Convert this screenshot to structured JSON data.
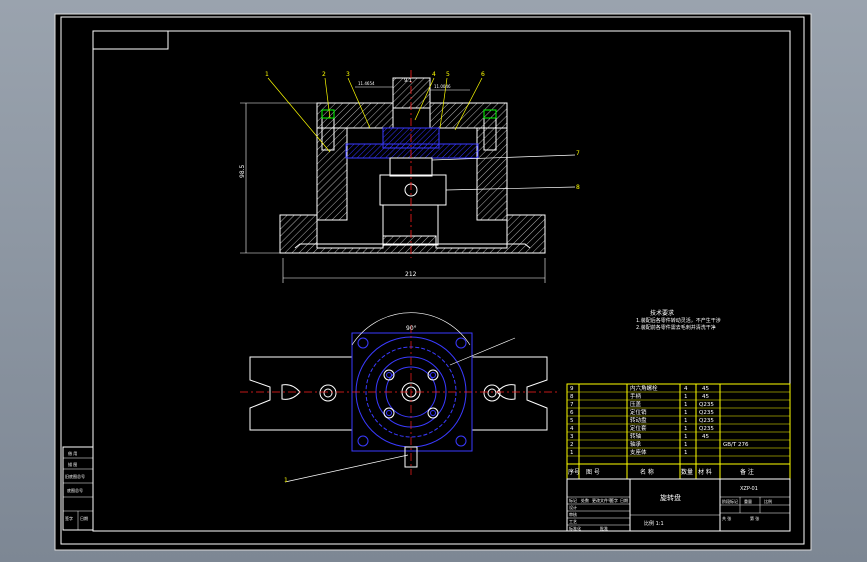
{
  "colors": {
    "background_outer": "#8a939e",
    "sheet": "#000000",
    "line_white": "#ffffff",
    "line_yellow": "#ffff00",
    "line_blue": "#2222ff",
    "line_green": "#00ff00",
    "line_red": "#ff2020"
  },
  "drawing": {
    "title": "旋转盘",
    "scale": "比例 1:1",
    "drawing_no": "XZP-01",
    "material_label": "材料"
  },
  "dimensions": {
    "width_bottom": "212",
    "height_left": "98.5",
    "top_left": "11.4654",
    "top_mid": "9.1",
    "top_right": "11.0046",
    "angle": "90°"
  },
  "balloons": [
    "1",
    "2",
    "3",
    "4",
    "5",
    "6",
    "7",
    "8"
  ],
  "notes": {
    "heading": "技术要求",
    "line1": "1.装配后各零件转动灵活，不产生干涉",
    "line2": "2.装配前各零件需去毛刺并清洗干净"
  },
  "bom": {
    "rows": [
      {
        "no": "9",
        "name": "内六角螺栓",
        "qty": "4",
        "material": "45",
        "note": ""
      },
      {
        "no": "8",
        "name": "手柄",
        "qty": "1",
        "material": "45",
        "note": ""
      },
      {
        "no": "7",
        "name": "压盖",
        "qty": "1",
        "material": "Q235",
        "note": ""
      },
      {
        "no": "6",
        "name": "定位销",
        "qty": "1",
        "material": "Q235",
        "note": ""
      },
      {
        "no": "5",
        "name": "转动盘",
        "qty": "1",
        "material": "Q235",
        "note": ""
      },
      {
        "no": "4",
        "name": "定位套",
        "qty": "1",
        "material": "Q235",
        "note": ""
      },
      {
        "no": "3",
        "name": "转轴",
        "qty": "1",
        "material": "45",
        "note": ""
      },
      {
        "no": "2",
        "name": "轴承",
        "qty": "1",
        "material": "",
        "note": "GB/T 276"
      },
      {
        "no": "1",
        "name": "支座体",
        "qty": "1",
        "material": "",
        "note": ""
      }
    ],
    "header": {
      "no": "序号",
      "code": "图 号",
      "name": "名 称",
      "qty": "数量",
      "material": "材 料",
      "note": "备 注"
    }
  },
  "side_block": {
    "r1": "借 用",
    "r2": "描 图",
    "r3": "旧底图总号",
    "r4": "底图总号",
    "r5": "签字",
    "r6": "日期"
  },
  "title_block": {
    "c1": "标记",
    "c2": "处数",
    "c3": "更改文件号",
    "c4": "签字",
    "c5": "日期",
    "c6": "设计",
    "c7": "审核",
    "c8": "工艺",
    "c9": "标准化",
    "c10": "批准",
    "c11": "阶段标记",
    "c12": "重量",
    "c13": "比例",
    "c14": "共 张",
    "c15": "第 张"
  }
}
